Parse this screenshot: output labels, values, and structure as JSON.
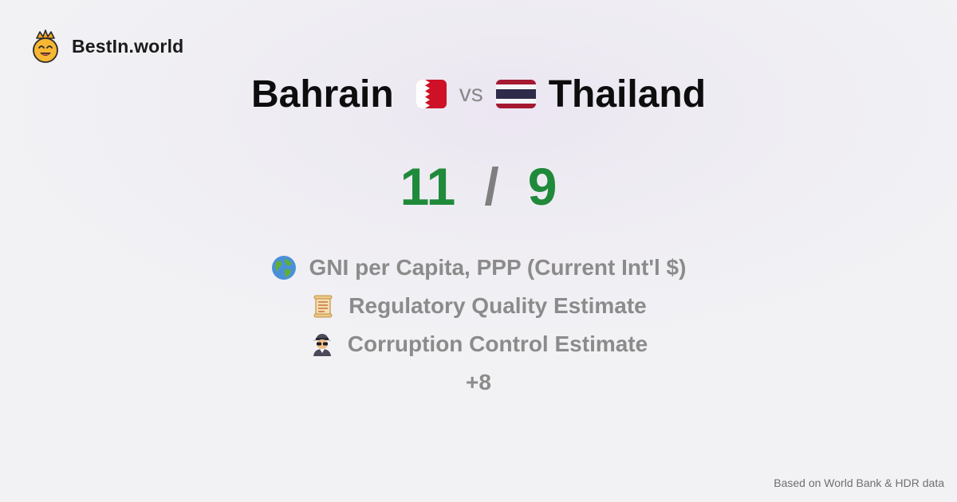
{
  "brand": {
    "name": "BestIn.world",
    "logo_icon": "crown-smiley-icon"
  },
  "comparison": {
    "left": {
      "name": "Bahrain",
      "flag_icon": "bahrain-flag-icon",
      "score": "11"
    },
    "vs_label": "vs",
    "right": {
      "name": "Thailand",
      "flag_icon": "thailand-flag-icon",
      "score": "9"
    },
    "separator": "/"
  },
  "metrics": [
    {
      "icon": "globe-icon",
      "label": "GNI per Capita, PPP (Current Int'l $)"
    },
    {
      "icon": "scroll-icon",
      "label": "Regulatory Quality Estimate"
    },
    {
      "icon": "detective-icon",
      "label": "Corruption Control Estimate"
    }
  ],
  "more_label": "+8",
  "footer": {
    "source": "Based on World Bank & HDR data"
  },
  "colors": {
    "score": "#1f8a3a",
    "muted": "#8b8b8b",
    "bahrain_red": "#ce1126",
    "thai_red": "#a51931",
    "thai_blue": "#2d2a4a"
  }
}
